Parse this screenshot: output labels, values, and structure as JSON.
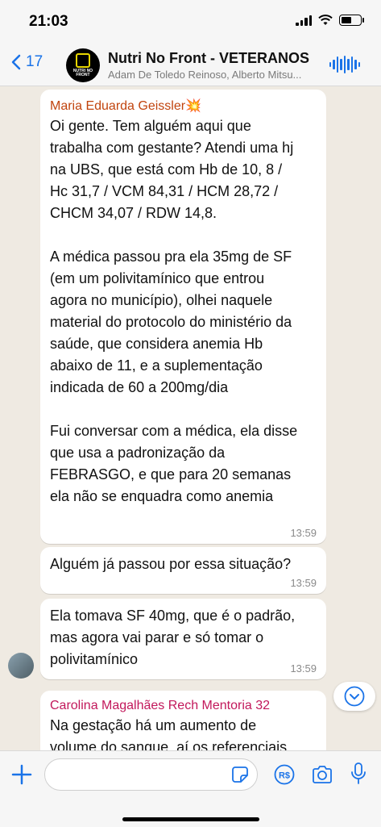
{
  "status_bar": {
    "time": "21:03"
  },
  "header": {
    "back_count": "17",
    "title": "Nutri No Front - VETERANOS",
    "subtitle": "Adam De Toledo Reinoso, Alberto Mitsu...",
    "group_logo_text": "NUTRI NO FRONT"
  },
  "messages": [
    {
      "sender": "Maria Eduarda Geissler💥",
      "sender_color": "#c1440e",
      "text": "Oi gente. Tem alguém aqui que\ntrabalha com gestante? Atendi uma hj\nna UBS, que está com Hb de 10, 8 /\nHc 31,7 / VCM 84,31 / HCM 28,72 /\nCHCM 34,07 / RDW 14,8.\n\nA médica passou pra ela 35mg de SF\n(em um polivitamínico que entrou\nagora no município), olhei naquele\nmaterial do protocolo do ministério da\nsaúde, que considera anemia Hb\nabaixo de 11, e a suplementação\nindicada de 60 a 200mg/dia\n\nFui conversar com a médica, ela disse\nque usa a padronização da\nFEBRASGO, e que para 20 semanas\nela não se enquadra como anemia",
      "time": "13:59"
    },
    {
      "text": "Alguém já passou por essa situação?",
      "time": "13:59"
    },
    {
      "text": "Ela tomava SF 40mg, que é o padrão,\nmas agora vai parar e só tomar o\npolivitamínico",
      "time": "13:59"
    },
    {
      "sender": "Carolina Magalhães Rech Mentoria 32",
      "sender_color": "#c2185b",
      "text": "Na gestação há um aumento de\nvolume do sangue, aí os referenciais"
    }
  ]
}
